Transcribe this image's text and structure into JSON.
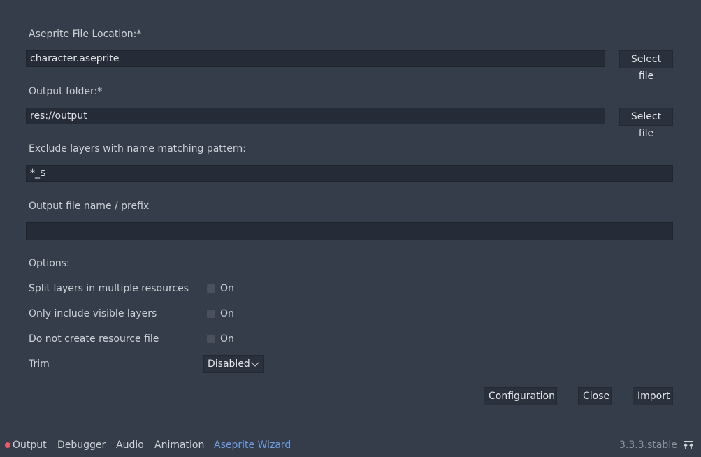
{
  "form": {
    "file_location_label": "Aseprite File Location:*",
    "file_location_value": "character.aseprite",
    "output_folder_label": "Output folder:*",
    "output_folder_value": "res://output",
    "select_file_label": "Select file",
    "exclude_label": "Exclude layers with name matching pattern:",
    "exclude_value": "*_$",
    "output_name_label": "Output file name / prefix",
    "output_name_value": ""
  },
  "options": {
    "heading": "Options:",
    "split_layers_label": "Split layers in multiple resources",
    "visible_layers_label": "Only include visible layers",
    "no_resource_label": "Do not create resource file",
    "on_text": "On",
    "split_layers_checked": false,
    "visible_layers_checked": false,
    "no_resource_checked": false,
    "trim_label": "Trim",
    "trim_value": "Disabled"
  },
  "actions": {
    "configuration": "Configuration",
    "close": "Close",
    "import": "Import"
  },
  "bottom_panel": {
    "tabs": [
      "Output",
      "Debugger",
      "Audio",
      "Animation",
      "Aseprite Wizard"
    ],
    "active_tab": "Aseprite Wizard",
    "version": "3.3.3.stable",
    "output_indicator_color": "#e45b6a",
    "pin_icon": "pin-panel-icon"
  }
}
